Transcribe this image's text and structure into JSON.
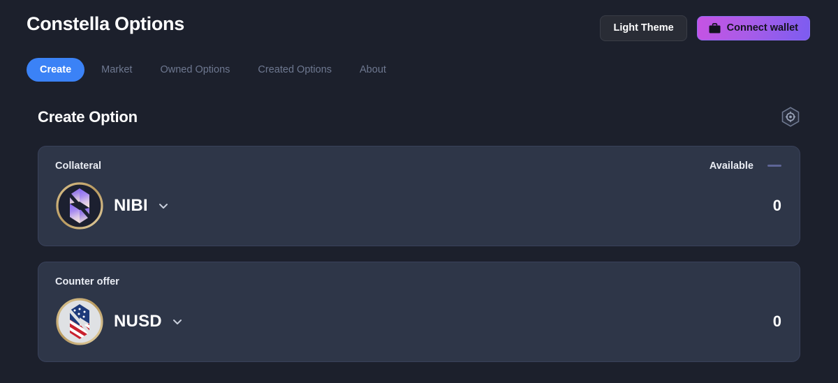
{
  "header": {
    "app_title": "Constella Options",
    "theme_button": "Light Theme",
    "wallet_button": "Connect wallet",
    "wallet_icon": "briefcase-icon"
  },
  "tabs": [
    {
      "label": "Create",
      "active": true
    },
    {
      "label": "Market",
      "active": false
    },
    {
      "label": "Owned Options",
      "active": false
    },
    {
      "label": "Created Options",
      "active": false
    },
    {
      "label": "About",
      "active": false
    }
  ],
  "section": {
    "title": "Create Option",
    "settings_icon": "hexagon-gear-icon"
  },
  "cards": [
    {
      "label": "Collateral",
      "available_label": "Available",
      "available_value": "—",
      "token": "NIBI",
      "token_logo": "nibi-logo-icon",
      "chevron": "chevron-down-icon",
      "amount": "0"
    },
    {
      "label": "Counter offer",
      "available_label": "",
      "available_value": "",
      "token": "NUSD",
      "token_logo": "nusd-logo-icon",
      "chevron": "chevron-down-icon",
      "amount": "0"
    }
  ],
  "colors": {
    "page_bg": "#1c202c",
    "card_bg": "#2e3648",
    "accent_blue": "#3b82f6",
    "wallet_gradient_start": "#c653e3",
    "wallet_gradient_end": "#7c5cf0",
    "muted_text": "#6e7890",
    "dash": "#5e6596"
  }
}
